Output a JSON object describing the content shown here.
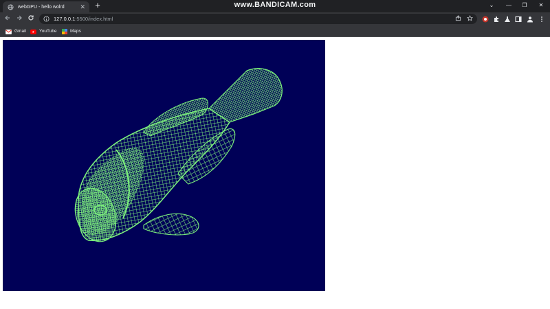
{
  "browser": {
    "tab": {
      "title": "webGPU - hello wolrd",
      "close_glyph": "✕",
      "favicon": "globe-icon"
    },
    "new_tab_glyph": "+",
    "watermark": "www.BANDICAM.com",
    "window_controls": {
      "dropdown": "⌄",
      "minimize": "—",
      "restore": "❐",
      "close": "✕"
    },
    "address": {
      "host": "127.0.0.1",
      "rest": ":5500/index.html"
    },
    "bookmarks": [
      {
        "label": "Gmail",
        "icon": "gmail-icon"
      },
      {
        "label": "YouTube",
        "icon": "youtube-icon"
      },
      {
        "label": "Maps",
        "icon": "maps-icon"
      }
    ]
  },
  "canvas": {
    "background": "#000057",
    "wire_color": "#7cf07c",
    "subject": "wireframe fish mesh"
  }
}
